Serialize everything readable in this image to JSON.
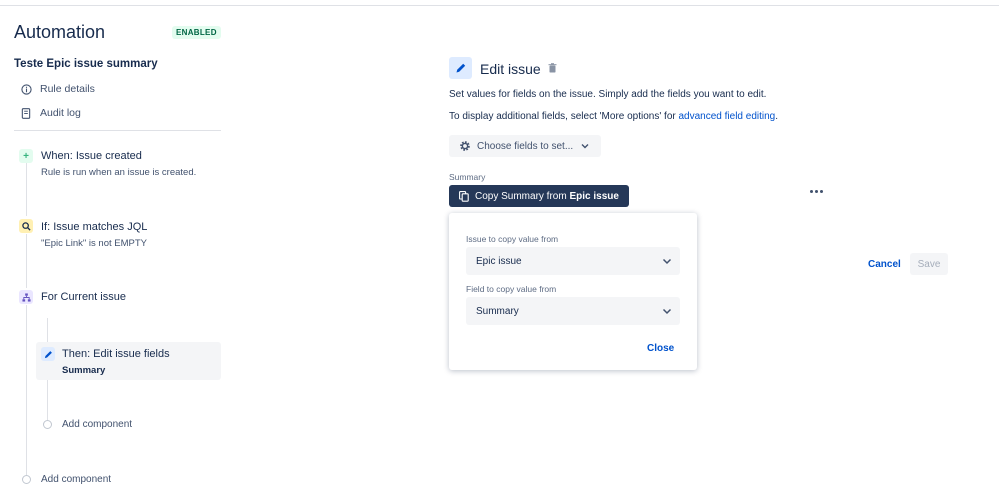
{
  "app": {
    "title": "Automation",
    "status_badge": "ENABLED"
  },
  "rule": {
    "name": "Teste Epic issue summary",
    "nav": [
      {
        "label": "Rule details",
        "icon": "info-icon"
      },
      {
        "label": "Audit log",
        "icon": "document-icon"
      }
    ]
  },
  "timeline": {
    "trigger": {
      "title": "When: Issue created",
      "subtitle": "Rule is run when an issue is created.",
      "icon": "plus-icon",
      "color": "#36b37e"
    },
    "condition": {
      "title": "If: Issue matches JQL",
      "subtitle": "\"Epic Link\" is not EMPTY",
      "icon": "search-icon",
      "color": "#ffab00"
    },
    "branch": {
      "title": "For Current issue",
      "icon": "branch-icon",
      "color": "#6554c0"
    },
    "action": {
      "title": "Then: Edit issue fields",
      "subtitle": "Summary",
      "icon": "pencil-icon",
      "color": "#0052cc"
    },
    "add_inner": "Add component",
    "add_outer": "Add component"
  },
  "editor": {
    "title": "Edit issue",
    "description": "Set values for fields on the issue. Simply add the fields you want to edit.",
    "more_prefix": "To display additional fields, select 'More options' for ",
    "more_link": "advanced field editing",
    "more_suffix": ".",
    "choose_label": "Choose fields to set...",
    "field_label": "Summary",
    "copy_prefix": "Copy Summary from ",
    "copy_bold": "Epic issue",
    "popup": {
      "issue_label": "Issue to copy value from",
      "issue_value": "Epic issue",
      "field_label": "Field to copy value from",
      "field_value": "Summary",
      "close": "Close"
    },
    "cancel": "Cancel",
    "save": "Save"
  }
}
